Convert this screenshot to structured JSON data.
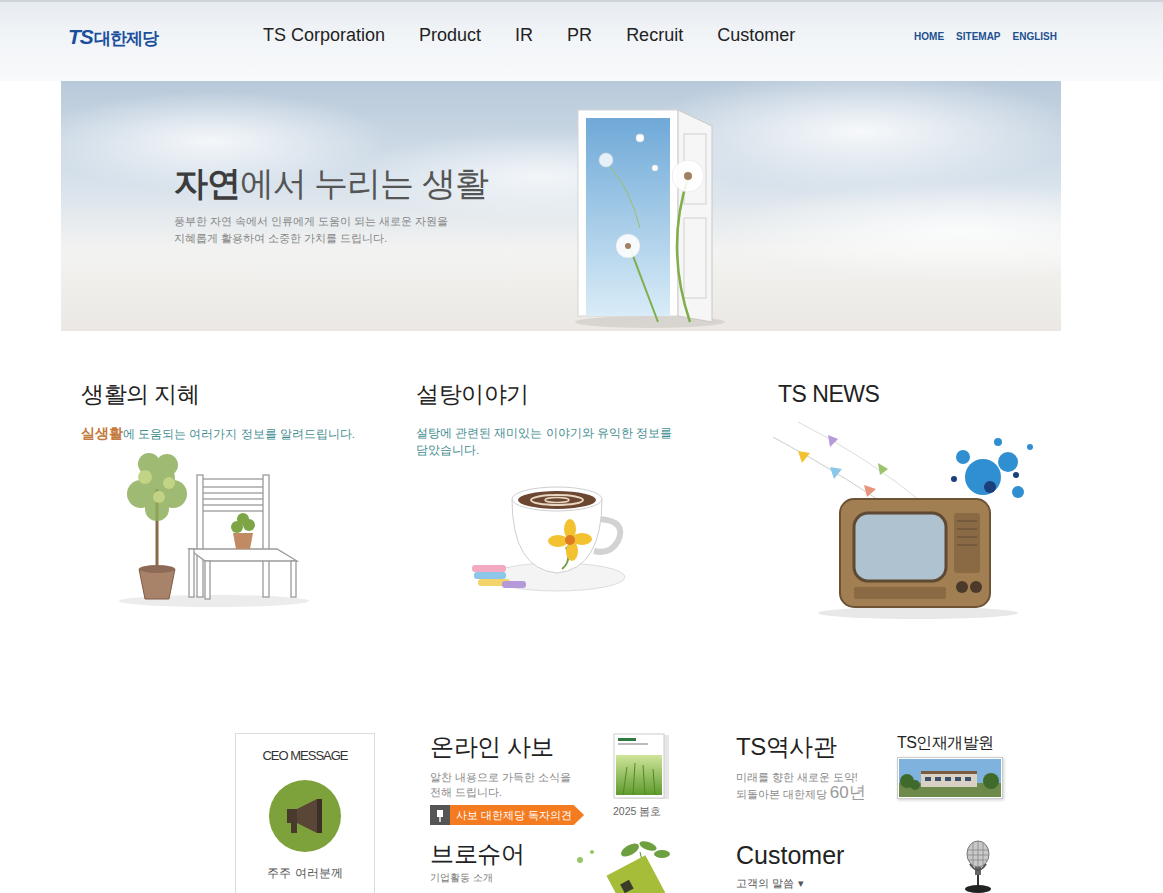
{
  "header": {
    "logo": {
      "mark": "TS",
      "name": "대한제당"
    },
    "nav": [
      {
        "label": "TS Corporation"
      },
      {
        "label": "Product"
      },
      {
        "label": "IR"
      },
      {
        "label": "PR"
      },
      {
        "label": "Recruit"
      },
      {
        "label": "Customer"
      }
    ],
    "utility": [
      "HOME",
      "SITEMAP",
      "ENGLISH"
    ]
  },
  "hero": {
    "title": [
      {
        "text": "자연",
        "accent": true
      },
      {
        "text": "에서 누리는 생활",
        "accent": false
      }
    ],
    "lines": [
      "풍부한 자연 속에서 인류에게 도움이 되는 새로운 자원을",
      "지혜롭게 활용하여 소중한 가치를 드립니다."
    ]
  },
  "features": [
    {
      "title": "생활의 지혜",
      "lines": [
        [
          {
            "text": "실생활",
            "accent": true
          },
          {
            "text": "에 도움되는 여러가지 정보를 알려드립니다.",
            "accent": false
          }
        ]
      ]
    },
    {
      "title": "설탕이야기",
      "lines": [
        [
          {
            "text": "설탕에 관련된 재미있는 이야기와 유익한 정보를",
            "accent": false
          }
        ],
        [
          {
            "text": "담았습니다.",
            "accent": false
          }
        ]
      ]
    },
    {
      "title": "TS NEWS",
      "lines": []
    }
  ],
  "ceo": {
    "title": "CEO MESSAGE",
    "caption": "주주 여러분께"
  },
  "webzine": {
    "title": "온라인 사보",
    "lines": [
      "알찬 내용으로 가득한 소식을",
      "전해 드립니다."
    ],
    "button": "사보 대한제당 독자의견",
    "issue": "2025 봄호"
  },
  "history": {
    "title": "TS역사관",
    "lines": [
      [
        {
          "text": "미래를 향한 새로운 도약!",
          "accent": false
        }
      ],
      [
        {
          "text": "되돌아본 대한제당 ",
          "accent": false
        },
        {
          "text": "60년",
          "accent": true
        }
      ]
    ]
  },
  "training": {
    "title": "TS인재개발원"
  },
  "brochure": {
    "title": "브로슈어",
    "desc": "기업활동 소개"
  },
  "customer": {
    "title": "Customer",
    "menu": "고객의 말씀",
    "caret": "▾"
  }
}
